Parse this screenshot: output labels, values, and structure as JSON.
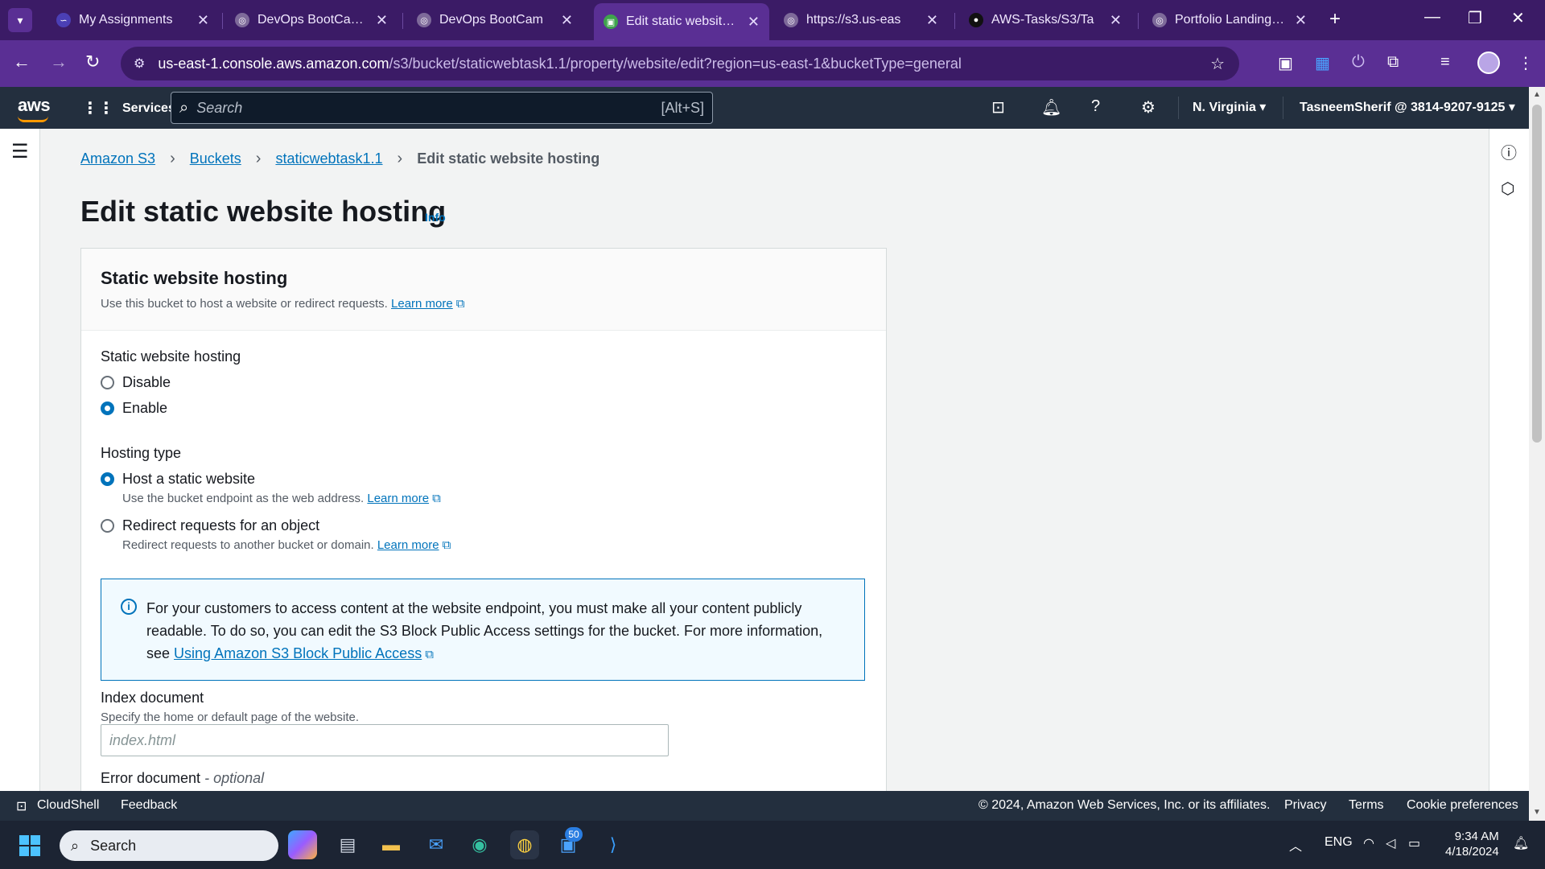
{
  "browser": {
    "tabs": [
      {
        "title": "My Assignments",
        "active": false
      },
      {
        "title": "DevOps BootCamp |",
        "active": false
      },
      {
        "title": "DevOps BootCam",
        "active": false
      },
      {
        "title": "Edit static website h",
        "active": true
      },
      {
        "title": "https://s3.us-eas",
        "active": false
      },
      {
        "title": "AWS-Tasks/S3/Ta",
        "active": false
      },
      {
        "title": "Portfolio Landing Pa",
        "active": false
      }
    ],
    "url_host": "us-east-1.console.aws.amazon.com",
    "url_path": "/s3/bucket/staticwebtask1.1/property/website/edit?region=us-east-1&bucketType=general"
  },
  "aws_nav": {
    "logo": "aws",
    "services_label": "Services",
    "search_placeholder": "Search",
    "search_shortcut": "[Alt+S]",
    "region": "N. Virginia",
    "account": "TasneemSherif @ 3814-9207-9125"
  },
  "breadcrumb": {
    "items": [
      "Amazon S3",
      "Buckets",
      "staticwebtask1.1"
    ],
    "current": "Edit static website hosting"
  },
  "page": {
    "title": "Edit static website hosting",
    "info_label": "Info"
  },
  "card": {
    "title": "Static website hosting",
    "description": "Use this bucket to host a website or redirect requests.",
    "learn_more": "Learn more",
    "hosting_label": "Static website hosting",
    "hosting_options": {
      "disable": "Disable",
      "enable": "Enable"
    },
    "hosting_selected": "Enable",
    "type_label": "Hosting type",
    "type_host": {
      "label": "Host a static website",
      "description": "Use the bucket endpoint as the web address.",
      "link": "Learn more"
    },
    "type_redirect": {
      "label": "Redirect requests for an object",
      "description": "Redirect requests to another bucket or domain.",
      "link": "Learn more"
    },
    "type_selected": "Host a static website",
    "alert": {
      "text": "For your customers to access content at the website endpoint, you must make all your content publicly readable. To do so, you can edit the S3 Block Public Access settings for the bucket. For more information, see",
      "link": "Using Amazon S3 Block Public Access"
    },
    "index_document": {
      "label": "Index document",
      "description": "Specify the home or default page of the website.",
      "placeholder": "index.html",
      "value": ""
    },
    "error_document": {
      "label": "Error document",
      "suffix": "- optional"
    }
  },
  "footer": {
    "cloudshell": "CloudShell",
    "feedback": "Feedback",
    "copyright": "© 2024, Amazon Web Services, Inc. or its affiliates.",
    "privacy": "Privacy",
    "terms": "Terms",
    "cookies": "Cookie preferences"
  },
  "taskbar": {
    "search_placeholder": "Search",
    "mail_badge": "50",
    "language": "ENG",
    "time": "9:34 AM",
    "date": "4/18/2024"
  },
  "colors": {
    "chrome_tabbar": "#3b1b66",
    "chrome_toolbar": "#5a2f94",
    "aws_nav": "#232f3e",
    "link": "#0073bb",
    "alert_bg": "#f1faff"
  }
}
